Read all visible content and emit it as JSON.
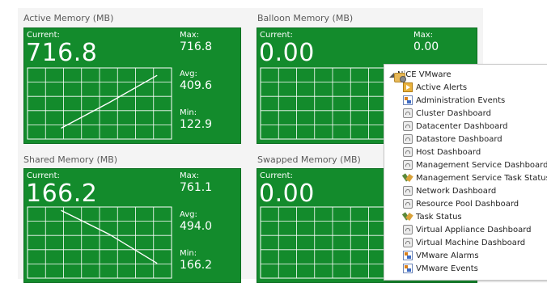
{
  "tiles": [
    {
      "title": "Active Memory (MB)",
      "current_label": "Current:",
      "current": "716.8",
      "max_label": "Max:",
      "max": "716.8",
      "avg_label": "Avg:",
      "avg": "409.6",
      "min_label": "Min:",
      "min": "122.9"
    },
    {
      "title": "Balloon Memory (MB)",
      "current_label": "Current:",
      "current": "0.00",
      "max_label": "Max:",
      "max": "0.00"
    },
    {
      "title": "Shared Memory (MB)",
      "current_label": "Current:",
      "current": "166.2",
      "max_label": "Max:",
      "max": "761.1",
      "avg_label": "Avg:",
      "avg": "494.0",
      "min_label": "Min:",
      "min": "166.2"
    },
    {
      "title": "Swapped Memory (MB)",
      "current_label": "Current:",
      "current": "0.00"
    }
  ],
  "chart_data": [
    {
      "type": "line",
      "title": "Active Memory (MB)",
      "x": [
        1,
        2,
        3
      ],
      "values": [
        122.9,
        409.6,
        716.8
      ],
      "ylim": [
        0,
        800
      ],
      "grid": true
    },
    {
      "type": "line",
      "title": "Shared Memory (MB)",
      "x": [
        1,
        2,
        3
      ],
      "values": [
        761.1,
        494.0,
        166.2
      ],
      "ylim": [
        0,
        800
      ],
      "grid": true
    }
  ],
  "tree": {
    "root": {
      "label": "NiCE VMware",
      "icon": "folder-icon"
    },
    "items": [
      {
        "label": "Active Alerts",
        "icon": "alerts"
      },
      {
        "label": "Administration Events",
        "icon": "events"
      },
      {
        "label": "Cluster Dashboard",
        "icon": "dash"
      },
      {
        "label": "Datacenter Dashboard",
        "icon": "dash"
      },
      {
        "label": "Datastore Dashboard",
        "icon": "dash"
      },
      {
        "label": "Host Dashboard",
        "icon": "dash"
      },
      {
        "label": "Management Service Dashboard",
        "icon": "dash"
      },
      {
        "label": "Management Service Task Status",
        "icon": "task"
      },
      {
        "label": "Network Dashboard",
        "icon": "dash"
      },
      {
        "label": "Resource Pool Dashboard",
        "icon": "dash"
      },
      {
        "label": "Task Status",
        "icon": "task"
      },
      {
        "label": "Virtual Appliance Dashboard",
        "icon": "dash"
      },
      {
        "label": "Virtual Machine Dashboard",
        "icon": "dash"
      },
      {
        "label": "VMware Alarms",
        "icon": "events"
      },
      {
        "label": "VMware Events",
        "icon": "events"
      }
    ]
  },
  "colors": {
    "card": "#138b2c",
    "grid": "#ffffff"
  }
}
